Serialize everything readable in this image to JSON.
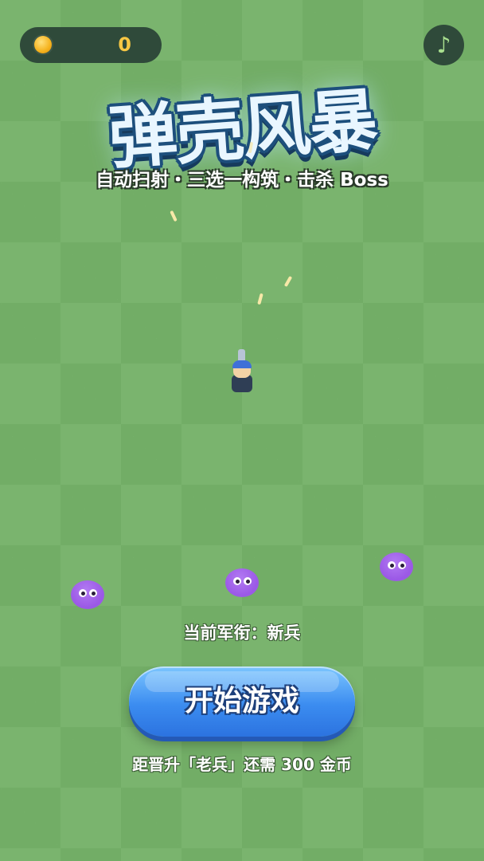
{
  "hud": {
    "coin_icon": "coin-icon",
    "coin_count": "0",
    "music_icon": "♪"
  },
  "title": {
    "main": "弹壳风暴",
    "subtitle": "自动扫射・三选一构筑・击杀 Boss"
  },
  "player": {
    "icon": "soldier-icon"
  },
  "enemies": [
    "slime-icon",
    "slime-icon",
    "slime-icon"
  ],
  "rank": {
    "label": "当前军衔：",
    "value": "新兵"
  },
  "start_button": {
    "label": "开始游戏"
  },
  "promotion": {
    "text": "距晋升「老兵」还需 300 金币"
  },
  "colors": {
    "accent": "#3b8cf0",
    "coin": "#f7c744",
    "slime": "#9b59e6",
    "hud_bg": "#2f4a3a"
  }
}
